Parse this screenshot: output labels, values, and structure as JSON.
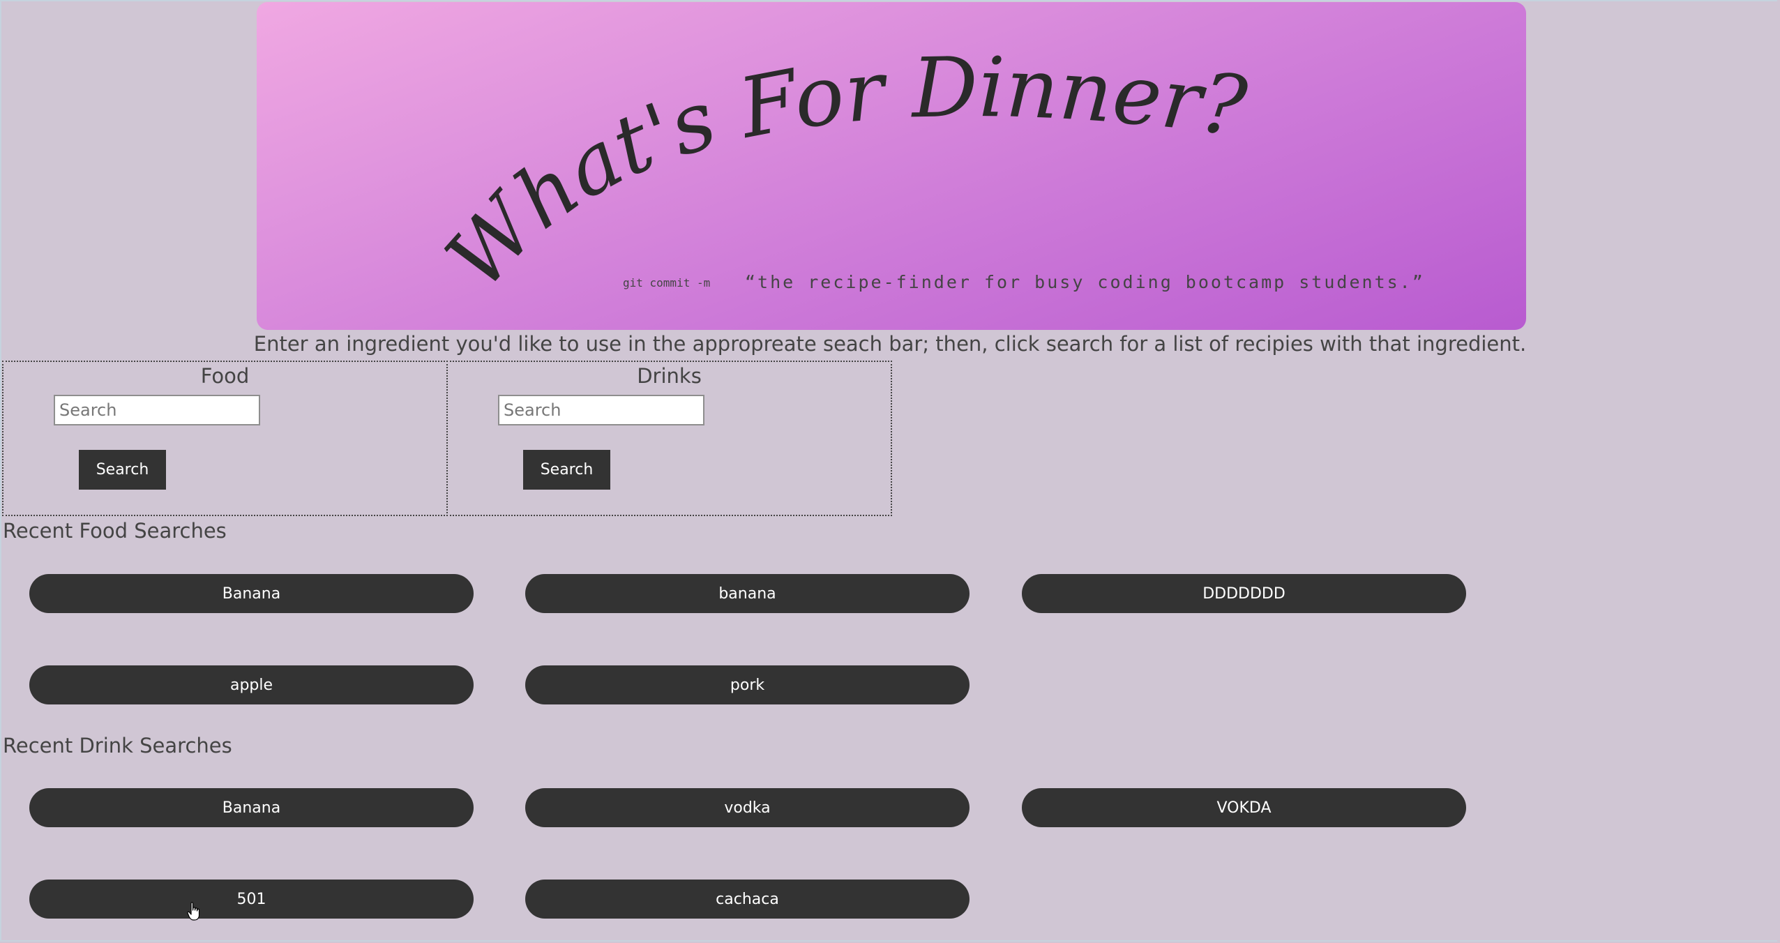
{
  "banner": {
    "title_text": "What's For Dinner?",
    "tagline_prefix": "git commit -m",
    "tagline": "“the recipe-finder for busy coding bootcamp students.”",
    "gradient_start": "#f0a8e2",
    "gradient_end": "#b85bd0"
  },
  "instructions": "Enter an ingredient you'd like to use in the appropreate seach bar; then, click search for a list of recipies with that ingredient.",
  "food_panel": {
    "title": "Food",
    "placeholder": "Search",
    "button_label": "Search"
  },
  "drinks_panel": {
    "title": "Drinks",
    "placeholder": "Search",
    "button_label": "Search"
  },
  "recent_food": {
    "heading": "Recent Food Searches",
    "items": [
      "Banana",
      "banana",
      "DDDDDDD",
      "apple",
      "pork"
    ]
  },
  "recent_drinks": {
    "heading": "Recent Drink Searches",
    "items": [
      "Banana",
      "vodka",
      "VOKDA",
      "501",
      "cachaca"
    ]
  },
  "colors": {
    "page_background": "#d0c6d4",
    "button_background": "#333333",
    "button_text": "#ffffff"
  }
}
